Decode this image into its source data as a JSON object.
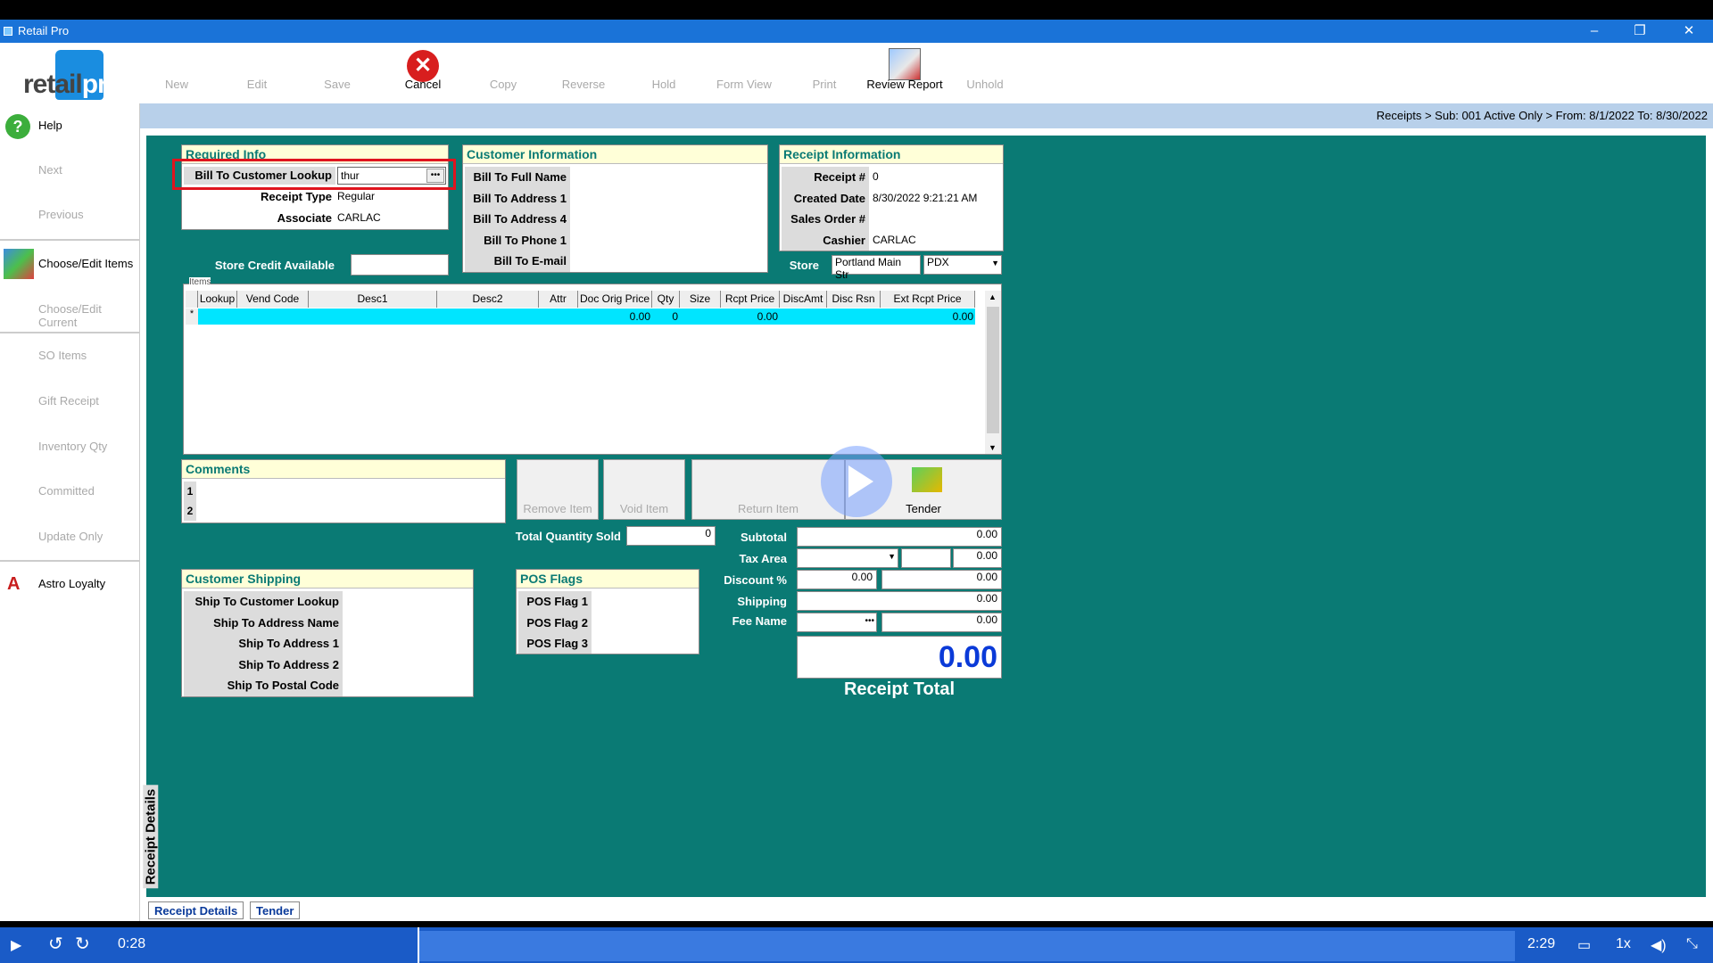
{
  "window": {
    "title": "Retail Pro",
    "minimize": "–",
    "restore": "❐",
    "close": "✕"
  },
  "logo": {
    "text_a": "retail",
    "text_b": "pro"
  },
  "toolbar": {
    "new": "New",
    "edit": "Edit",
    "save": "Save",
    "cancel": "Cancel",
    "copy": "Copy",
    "reverse": "Reverse",
    "hold": "Hold",
    "form_view": "Form View",
    "print": "Print",
    "review_report": "Review Report",
    "unhold": "Unhold"
  },
  "sidebar": {
    "help": "Help",
    "next": "Next",
    "previous": "Previous",
    "choose_edit_items": "Choose/Edit Items",
    "choose_edit_current": "Choose/Edit Current",
    "so_items": "SO Items",
    "gift_receipt": "Gift Receipt",
    "inventory_qty": "Inventory Qty",
    "committed": "Committed",
    "update_only": "Update Only",
    "astro_loyalty": "Astro Loyalty"
  },
  "breadcrumb": "Receipts > Sub: 001 Active Only > From: 8/1/2022 To: 8/30/2022",
  "required_info": {
    "title": "Required Info",
    "bill_to_lookup_label": "Bill To Customer Lookup",
    "bill_to_lookup_value": "thur",
    "receipt_type_label": "Receipt Type",
    "receipt_type_value": "Regular",
    "associate_label": "Associate",
    "associate_value": "CARLAC",
    "store_credit_label": "Store Credit Available"
  },
  "customer_info": {
    "title": "Customer Information",
    "full_name": "Bill To Full Name",
    "address1": "Bill To Address 1",
    "address4": "Bill To Address 4",
    "phone1": "Bill To Phone 1",
    "email": "Bill To E-mail"
  },
  "receipt_info": {
    "title": "Receipt Information",
    "receipt_no_label": "Receipt #",
    "receipt_no_value": "0",
    "created_label": "Created Date",
    "created_value": "8/30/2022 9:21:21 AM",
    "sales_order_label": "Sales Order #",
    "cashier_label": "Cashier",
    "cashier_value": "CARLAC",
    "store_label": "Store",
    "store_value": "Portland Main Str",
    "store_code": "PDX"
  },
  "items": {
    "title": "Items",
    "columns": [
      "Lookup",
      "Vend Code",
      "Desc1",
      "Desc2",
      "Attr",
      "Doc Orig Price",
      "Qty",
      "Size",
      "Rcpt Price",
      "DiscAmt",
      "Disc Rsn",
      "Ext Rcpt Price"
    ],
    "row": {
      "marker": "*",
      "doc_orig_price": "0.00",
      "qty": "0",
      "rcpt_price": "0.00",
      "ext_rcpt_price": "0.00"
    }
  },
  "comments": {
    "title": "Comments",
    "line1": "1",
    "line2": "2"
  },
  "actions": {
    "remove_item": "Remove Item",
    "void_item": "Void Item",
    "return_item": "Return Item",
    "tender": "Tender"
  },
  "totals": {
    "total_qty_label": "Total Quantity Sold",
    "total_qty_value": "0",
    "subtotal_label": "Subtotal",
    "subtotal_value": "0.00",
    "tax_area_label": "Tax Area",
    "tax_value": "0.00",
    "discount_label": "Discount %",
    "discount_pct": "0.00",
    "discount_value": "0.00",
    "shipping_label": "Shipping",
    "shipping_value": "0.00",
    "fee_label": "Fee Name",
    "fee_value": "0.00",
    "receipt_total_value": "0.00",
    "receipt_total_label": "Receipt Total"
  },
  "customer_shipping": {
    "title": "Customer Shipping",
    "lookup": "Ship To Customer Lookup",
    "address_name": "Ship To Address Name",
    "address1": "Ship To Address 1",
    "address2": "Ship To Address 2",
    "postal": "Ship To Postal Code"
  },
  "pos_flags": {
    "title": "POS Flags",
    "flag1": "POS Flag 1",
    "flag2": "POS Flag 2",
    "flag3": "POS Flag 3"
  },
  "tabs": {
    "vertical": "Receipt Details",
    "receipt_details": "Receipt Details",
    "tender": "Tender"
  },
  "video": {
    "current_time": "0:28",
    "duration": "2:29",
    "speed": "1x",
    "progress": 0.19
  },
  "colors": {
    "teal": "#0a7a74",
    "titlebar": "#1a73d8",
    "video_bar": "#1a5bc7",
    "highlight": "#e0141e",
    "row_cyan": "#00e5ff",
    "total_blue": "#0a3ad8"
  }
}
